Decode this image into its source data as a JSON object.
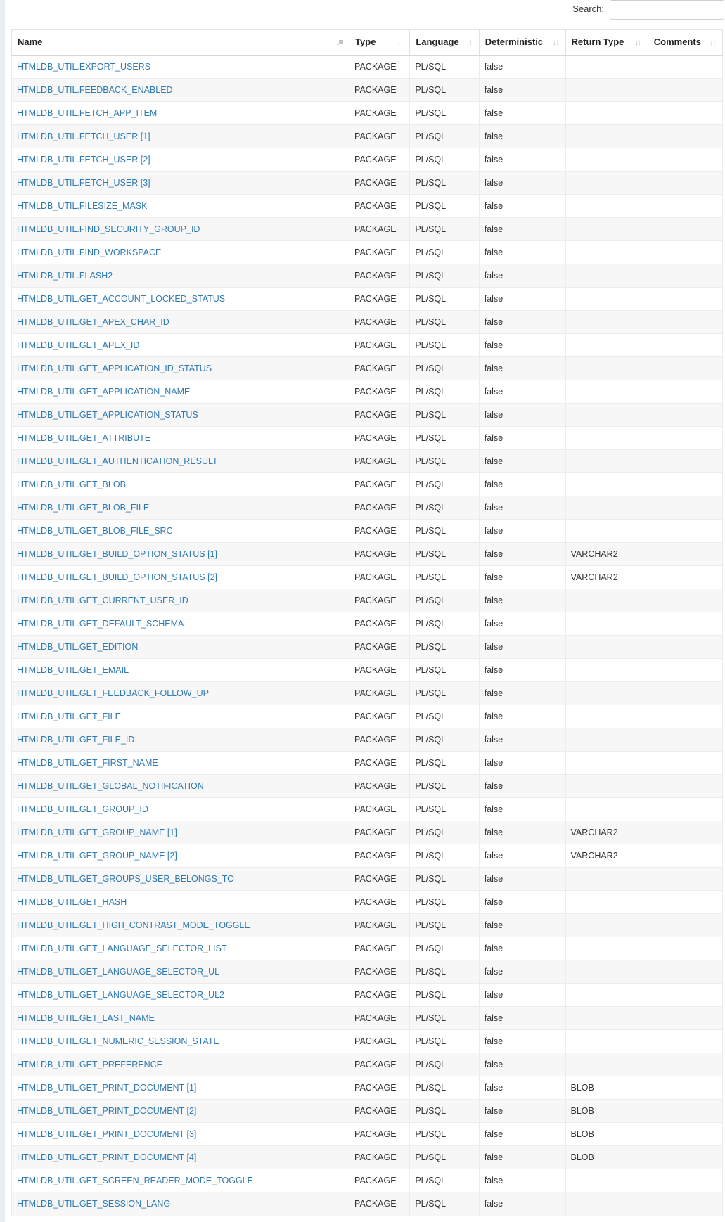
{
  "search": {
    "label": "Search:",
    "value": ""
  },
  "columns": [
    {
      "label": "Name",
      "sorted": true
    },
    {
      "label": "Type",
      "sorted": false
    },
    {
      "label": "Language",
      "sorted": false
    },
    {
      "label": "Deterministic",
      "sorted": false
    },
    {
      "label": "Return Type",
      "sorted": false
    },
    {
      "label": "Comments",
      "sorted": false
    }
  ],
  "rows": [
    [
      "HTMLDB_UTIL.EXPORT_USERS",
      "PACKAGE",
      "PL/SQL",
      "false",
      "",
      ""
    ],
    [
      "HTMLDB_UTIL.FEEDBACK_ENABLED",
      "PACKAGE",
      "PL/SQL",
      "false",
      "",
      ""
    ],
    [
      "HTMLDB_UTIL.FETCH_APP_ITEM",
      "PACKAGE",
      "PL/SQL",
      "false",
      "",
      ""
    ],
    [
      "HTMLDB_UTIL.FETCH_USER [1]",
      "PACKAGE",
      "PL/SQL",
      "false",
      "",
      ""
    ],
    [
      "HTMLDB_UTIL.FETCH_USER [2]",
      "PACKAGE",
      "PL/SQL",
      "false",
      "",
      ""
    ],
    [
      "HTMLDB_UTIL.FETCH_USER [3]",
      "PACKAGE",
      "PL/SQL",
      "false",
      "",
      ""
    ],
    [
      "HTMLDB_UTIL.FILESIZE_MASK",
      "PACKAGE",
      "PL/SQL",
      "false",
      "",
      ""
    ],
    [
      "HTMLDB_UTIL.FIND_SECURITY_GROUP_ID",
      "PACKAGE",
      "PL/SQL",
      "false",
      "",
      ""
    ],
    [
      "HTMLDB_UTIL.FIND_WORKSPACE",
      "PACKAGE",
      "PL/SQL",
      "false",
      "",
      ""
    ],
    [
      "HTMLDB_UTIL.FLASH2",
      "PACKAGE",
      "PL/SQL",
      "false",
      "",
      ""
    ],
    [
      "HTMLDB_UTIL.GET_ACCOUNT_LOCKED_STATUS",
      "PACKAGE",
      "PL/SQL",
      "false",
      "",
      ""
    ],
    [
      "HTMLDB_UTIL.GET_APEX_CHAR_ID",
      "PACKAGE",
      "PL/SQL",
      "false",
      "",
      ""
    ],
    [
      "HTMLDB_UTIL.GET_APEX_ID",
      "PACKAGE",
      "PL/SQL",
      "false",
      "",
      ""
    ],
    [
      "HTMLDB_UTIL.GET_APPLICATION_ID_STATUS",
      "PACKAGE",
      "PL/SQL",
      "false",
      "",
      ""
    ],
    [
      "HTMLDB_UTIL.GET_APPLICATION_NAME",
      "PACKAGE",
      "PL/SQL",
      "false",
      "",
      ""
    ],
    [
      "HTMLDB_UTIL.GET_APPLICATION_STATUS",
      "PACKAGE",
      "PL/SQL",
      "false",
      "",
      ""
    ],
    [
      "HTMLDB_UTIL.GET_ATTRIBUTE",
      "PACKAGE",
      "PL/SQL",
      "false",
      "",
      ""
    ],
    [
      "HTMLDB_UTIL.GET_AUTHENTICATION_RESULT",
      "PACKAGE",
      "PL/SQL",
      "false",
      "",
      ""
    ],
    [
      "HTMLDB_UTIL.GET_BLOB",
      "PACKAGE",
      "PL/SQL",
      "false",
      "",
      ""
    ],
    [
      "HTMLDB_UTIL.GET_BLOB_FILE",
      "PACKAGE",
      "PL/SQL",
      "false",
      "",
      ""
    ],
    [
      "HTMLDB_UTIL.GET_BLOB_FILE_SRC",
      "PACKAGE",
      "PL/SQL",
      "false",
      "",
      ""
    ],
    [
      "HTMLDB_UTIL.GET_BUILD_OPTION_STATUS [1]",
      "PACKAGE",
      "PL/SQL",
      "false",
      "VARCHAR2",
      ""
    ],
    [
      "HTMLDB_UTIL.GET_BUILD_OPTION_STATUS [2]",
      "PACKAGE",
      "PL/SQL",
      "false",
      "VARCHAR2",
      ""
    ],
    [
      "HTMLDB_UTIL.GET_CURRENT_USER_ID",
      "PACKAGE",
      "PL/SQL",
      "false",
      "",
      ""
    ],
    [
      "HTMLDB_UTIL.GET_DEFAULT_SCHEMA",
      "PACKAGE",
      "PL/SQL",
      "false",
      "",
      ""
    ],
    [
      "HTMLDB_UTIL.GET_EDITION",
      "PACKAGE",
      "PL/SQL",
      "false",
      "",
      ""
    ],
    [
      "HTMLDB_UTIL.GET_EMAIL",
      "PACKAGE",
      "PL/SQL",
      "false",
      "",
      ""
    ],
    [
      "HTMLDB_UTIL.GET_FEEDBACK_FOLLOW_UP",
      "PACKAGE",
      "PL/SQL",
      "false",
      "",
      ""
    ],
    [
      "HTMLDB_UTIL.GET_FILE",
      "PACKAGE",
      "PL/SQL",
      "false",
      "",
      ""
    ],
    [
      "HTMLDB_UTIL.GET_FILE_ID",
      "PACKAGE",
      "PL/SQL",
      "false",
      "",
      ""
    ],
    [
      "HTMLDB_UTIL.GET_FIRST_NAME",
      "PACKAGE",
      "PL/SQL",
      "false",
      "",
      ""
    ],
    [
      "HTMLDB_UTIL.GET_GLOBAL_NOTIFICATION",
      "PACKAGE",
      "PL/SQL",
      "false",
      "",
      ""
    ],
    [
      "HTMLDB_UTIL.GET_GROUP_ID",
      "PACKAGE",
      "PL/SQL",
      "false",
      "",
      ""
    ],
    [
      "HTMLDB_UTIL.GET_GROUP_NAME [1]",
      "PACKAGE",
      "PL/SQL",
      "false",
      "VARCHAR2",
      ""
    ],
    [
      "HTMLDB_UTIL.GET_GROUP_NAME [2]",
      "PACKAGE",
      "PL/SQL",
      "false",
      "VARCHAR2",
      ""
    ],
    [
      "HTMLDB_UTIL.GET_GROUPS_USER_BELONGS_TO",
      "PACKAGE",
      "PL/SQL",
      "false",
      "",
      ""
    ],
    [
      "HTMLDB_UTIL.GET_HASH",
      "PACKAGE",
      "PL/SQL",
      "false",
      "",
      ""
    ],
    [
      "HTMLDB_UTIL.GET_HIGH_CONTRAST_MODE_TOGGLE",
      "PACKAGE",
      "PL/SQL",
      "false",
      "",
      ""
    ],
    [
      "HTMLDB_UTIL.GET_LANGUAGE_SELECTOR_LIST",
      "PACKAGE",
      "PL/SQL",
      "false",
      "",
      ""
    ],
    [
      "HTMLDB_UTIL.GET_LANGUAGE_SELECTOR_UL",
      "PACKAGE",
      "PL/SQL",
      "false",
      "",
      ""
    ],
    [
      "HTMLDB_UTIL.GET_LANGUAGE_SELECTOR_UL2",
      "PACKAGE",
      "PL/SQL",
      "false",
      "",
      ""
    ],
    [
      "HTMLDB_UTIL.GET_LAST_NAME",
      "PACKAGE",
      "PL/SQL",
      "false",
      "",
      ""
    ],
    [
      "HTMLDB_UTIL.GET_NUMERIC_SESSION_STATE",
      "PACKAGE",
      "PL/SQL",
      "false",
      "",
      ""
    ],
    [
      "HTMLDB_UTIL.GET_PREFERENCE",
      "PACKAGE",
      "PL/SQL",
      "false",
      "",
      ""
    ],
    [
      "HTMLDB_UTIL.GET_PRINT_DOCUMENT [1]",
      "PACKAGE",
      "PL/SQL",
      "false",
      "BLOB",
      ""
    ],
    [
      "HTMLDB_UTIL.GET_PRINT_DOCUMENT [2]",
      "PACKAGE",
      "PL/SQL",
      "false",
      "BLOB",
      ""
    ],
    [
      "HTMLDB_UTIL.GET_PRINT_DOCUMENT [3]",
      "PACKAGE",
      "PL/SQL",
      "false",
      "BLOB",
      ""
    ],
    [
      "HTMLDB_UTIL.GET_PRINT_DOCUMENT [4]",
      "PACKAGE",
      "PL/SQL",
      "false",
      "BLOB",
      ""
    ],
    [
      "HTMLDB_UTIL.GET_SCREEN_READER_MODE_TOGGLE",
      "PACKAGE",
      "PL/SQL",
      "false",
      "",
      ""
    ],
    [
      "HTMLDB_UTIL.GET_SESSION_LANG",
      "PACKAGE",
      "PL/SQL",
      "false",
      "",
      ""
    ]
  ],
  "icons": {
    "sort_active": "sort-amount-down-icon",
    "sort_inactive": "sort-both-icon"
  }
}
